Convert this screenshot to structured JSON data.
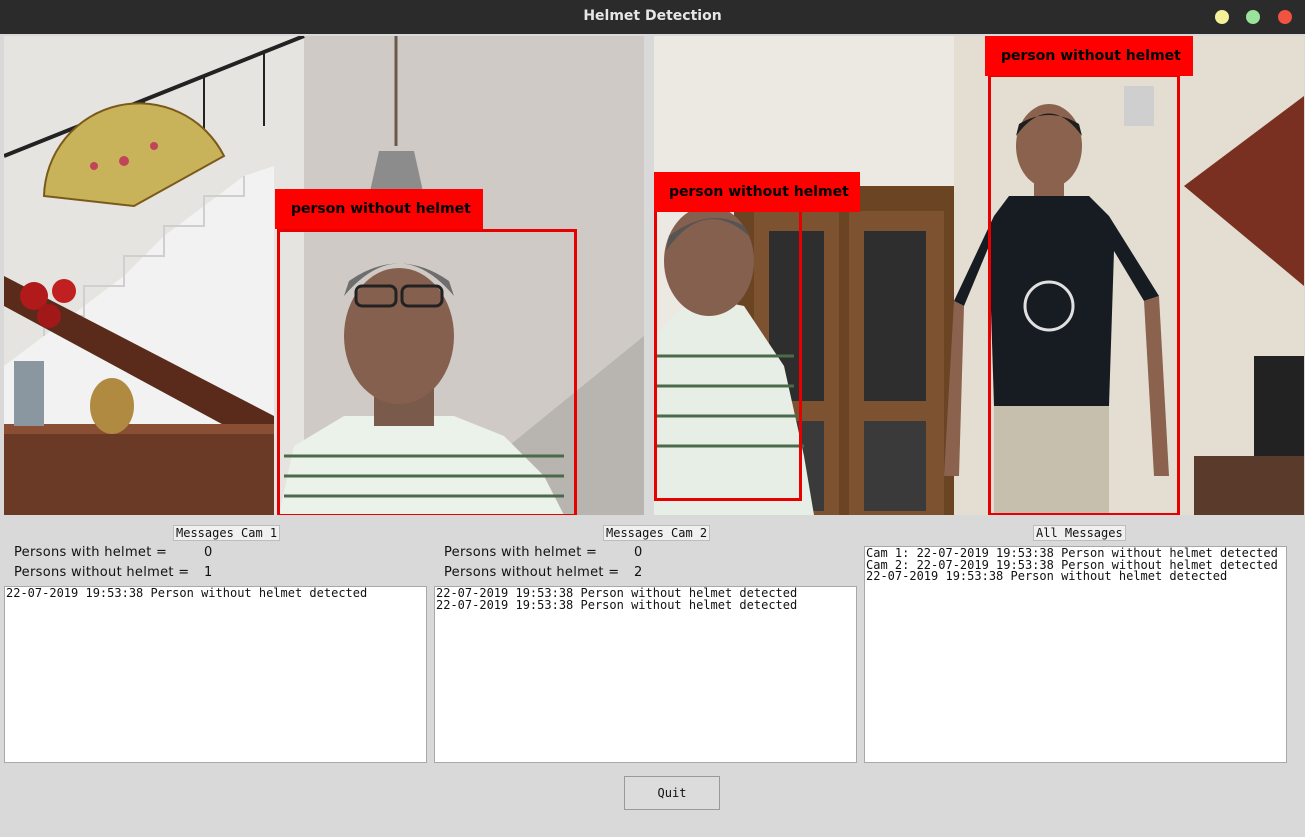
{
  "window": {
    "title": "Helmet Detection"
  },
  "cam1": {
    "detections": [
      {
        "label": "person without helmet"
      }
    ],
    "panel_title": "Messages Cam 1",
    "with_helmet_label": "Persons with helmet =",
    "with_helmet_value": "0",
    "without_helmet_label": "Persons without helmet =",
    "without_helmet_value": "1",
    "messages": [
      "22-07-2019 19:53:38 Person without helmet detected"
    ]
  },
  "cam2": {
    "detections": [
      {
        "label": "person without helmet"
      },
      {
        "label": "person without helmet"
      }
    ],
    "panel_title": "Messages Cam 2",
    "with_helmet_label": "Persons with helmet =",
    "with_helmet_value": "0",
    "without_helmet_label": "Persons without helmet =",
    "without_helmet_value": "2",
    "messages": [
      "22-07-2019 19:53:38 Person without helmet detected",
      "22-07-2019 19:53:38 Person without helmet detected"
    ]
  },
  "all": {
    "panel_title": "All Messages",
    "messages": [
      "Cam 1: 22-07-2019 19:53:38 Person without helmet detected",
      "Cam 2: 22-07-2019 19:53:38 Person without helmet detected",
      "22-07-2019 19:53:38 Person without helmet detected"
    ]
  },
  "quit_label": "Quit",
  "colors": {
    "detection": "#ff0000",
    "titlebar": "#2b2b2b",
    "background": "#d9d9d9"
  }
}
